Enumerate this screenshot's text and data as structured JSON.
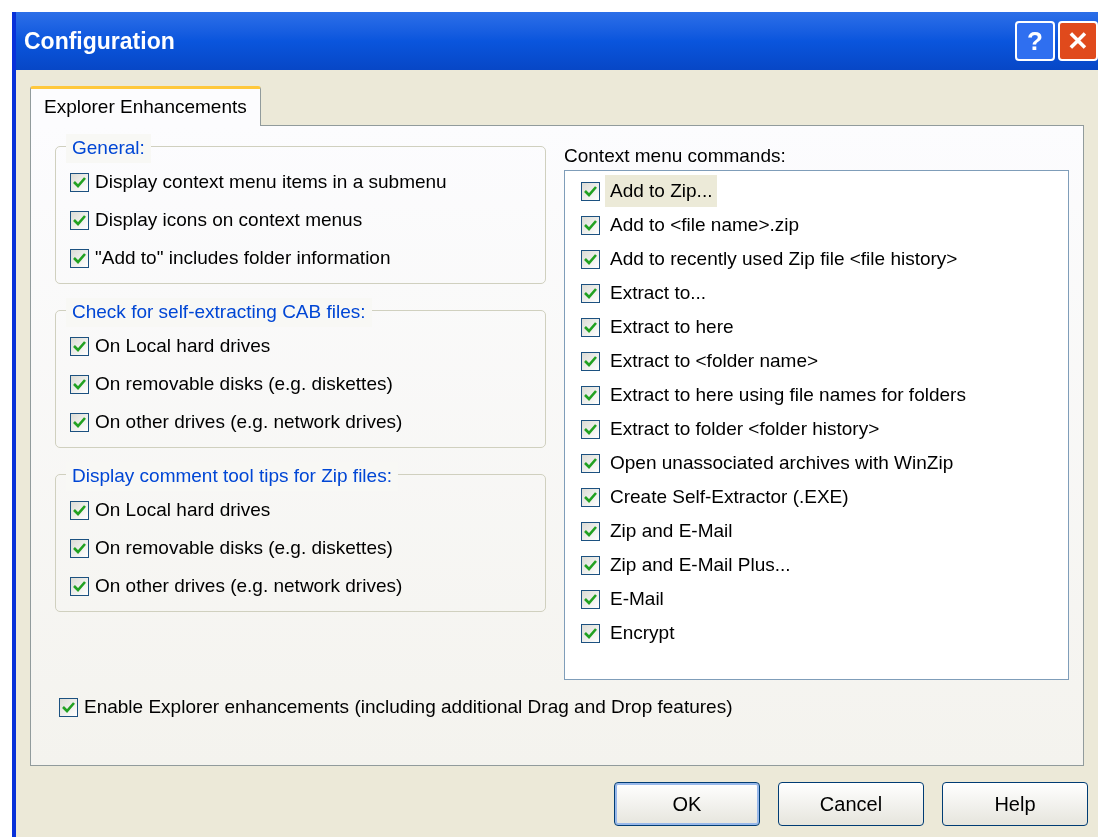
{
  "window": {
    "title": "Configuration",
    "title_buttons": [
      {
        "kind": "help",
        "label": "?"
      },
      {
        "kind": "close",
        "label": "✕"
      }
    ]
  },
  "tabs": [
    {
      "label": "Explorer Enhancements",
      "selected": true
    }
  ],
  "groups": [
    {
      "title": "General:",
      "options": [
        {
          "label": "Display context menu items in a submenu",
          "checked": true
        },
        {
          "label": "Display icons on context menus",
          "checked": true
        },
        {
          "label": "\"Add to\" includes folder information",
          "checked": true
        }
      ]
    },
    {
      "title": "Check for self-extracting CAB files:",
      "options": [
        {
          "label": "On Local hard drives",
          "checked": true
        },
        {
          "label": "On removable disks (e.g. diskettes)",
          "checked": true
        },
        {
          "label": "On other drives (e.g. network drives)",
          "checked": true
        }
      ]
    },
    {
      "title": "Display comment tool tips for Zip files:",
      "options": [
        {
          "label": "On Local hard drives",
          "checked": true
        },
        {
          "label": "On removable disks (e.g. diskettes)",
          "checked": true
        },
        {
          "label": "On other drives (e.g. network drives)",
          "checked": true
        }
      ]
    }
  ],
  "context_menu": {
    "label": "Context menu commands:",
    "items": [
      {
        "label": "Add to Zip...",
        "checked": true,
        "selected": true
      },
      {
        "label": "Add to <file name>.zip",
        "checked": true,
        "selected": false
      },
      {
        "label": "Add to recently used Zip file <file history>",
        "checked": true,
        "selected": false
      },
      {
        "label": "Extract to...",
        "checked": true,
        "selected": false
      },
      {
        "label": "Extract to here",
        "checked": true,
        "selected": false
      },
      {
        "label": "Extract to <folder name>",
        "checked": true,
        "selected": false
      },
      {
        "label": "Extract to here using file names for folders",
        "checked": true,
        "selected": false
      },
      {
        "label": "Extract to folder <folder history>",
        "checked": true,
        "selected": false
      },
      {
        "label": "Open unassociated archives with WinZip",
        "checked": true,
        "selected": false
      },
      {
        "label": "Create Self-Extractor (.EXE)",
        "checked": true,
        "selected": false
      },
      {
        "label": "Zip and E-Mail",
        "checked": true,
        "selected": false
      },
      {
        "label": "Zip and E-Mail Plus...",
        "checked": true,
        "selected": false
      },
      {
        "label": "E-Mail",
        "checked": true,
        "selected": false
      },
      {
        "label": "Encrypt",
        "checked": true,
        "selected": false
      }
    ]
  },
  "enable_option": {
    "label": "Enable Explorer enhancements (including additional Drag and Drop features)",
    "checked": true
  },
  "buttons": [
    {
      "label": "OK"
    },
    {
      "label": "Cancel"
    },
    {
      "label": "Help"
    }
  ]
}
